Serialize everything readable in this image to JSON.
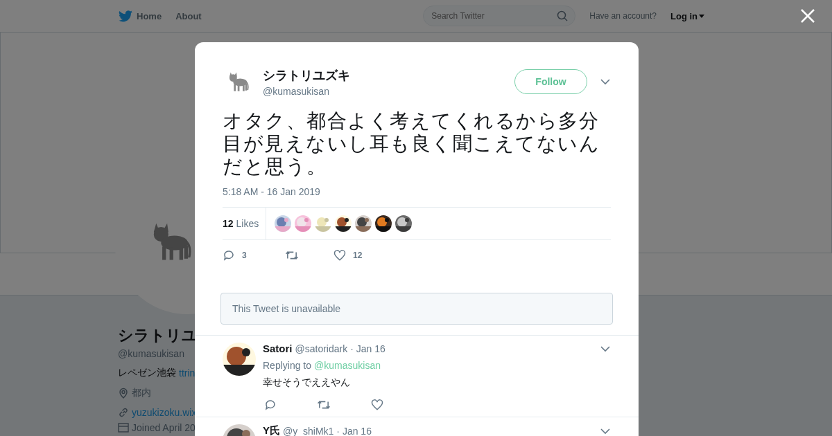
{
  "nav": {
    "items": [
      {
        "label": "Home"
      },
      {
        "label": "About"
      }
    ],
    "search": {
      "placeholder": "Search Twitter"
    },
    "account_prompt": "Have an account?",
    "login": "Log in"
  },
  "profile": {
    "name": "シラトリユ",
    "handle": "@kumasukisan",
    "bio": "レペゼン池袋",
    "bio_link": "ttrin",
    "location": "都内",
    "website": "yuzukizoku.wix",
    "joined": "Joined April 20"
  },
  "tweet": {
    "name": "シラトリユズキ",
    "handle": "@kumasukisan",
    "follow": "Follow",
    "text": "オタク、都合よく考えてくれるから多分目が見えないし耳も良く聞こえてないんだと思う。",
    "time": "5:18 AM - 16 Jan 2019",
    "likes_count": "12",
    "likes_label": "Likes",
    "reply_count": "3",
    "like_count": "12"
  },
  "quoted": "This Tweet is unavailable",
  "replies": [
    {
      "name": "Satori",
      "handle": "@satoridark",
      "date": "· Jan 16",
      "replying_label": "Replying to",
      "replying_to": "@kumasukisan",
      "text": "幸せそうでええやん"
    },
    {
      "name": "Y氏",
      "handle": "@y_shiMk1",
      "date": "· Jan 16"
    }
  ]
}
